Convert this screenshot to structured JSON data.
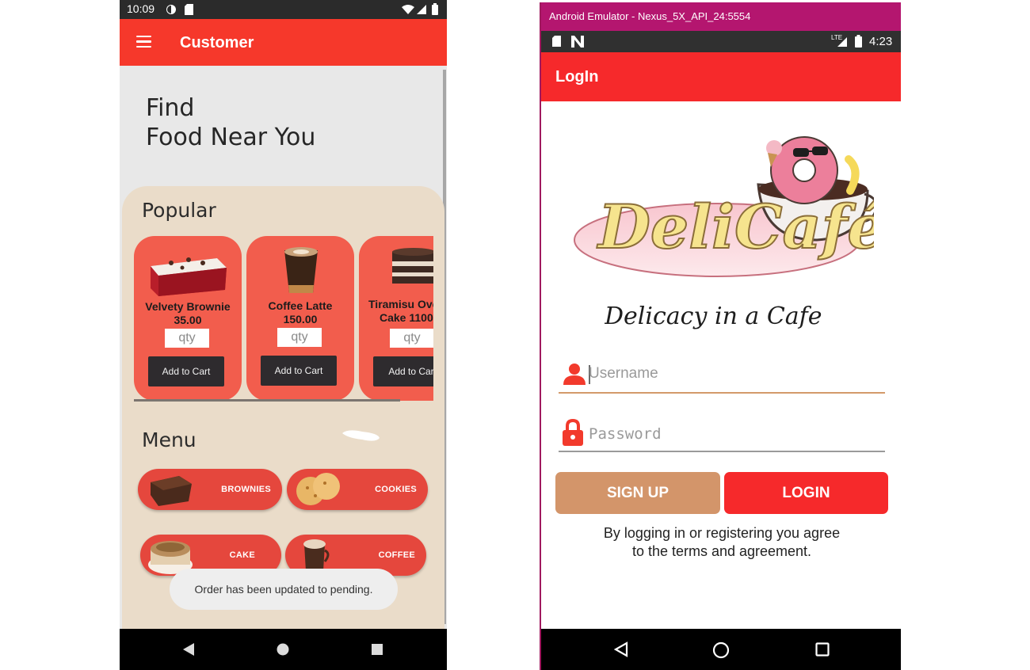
{
  "customer_screen": {
    "status_bar": {
      "time": "10:09"
    },
    "app_bar": {
      "title": "Customer",
      "menu_icon": "hamburger-icon"
    },
    "hero": {
      "line1": "Find",
      "line2": "Food Near You"
    },
    "popular": {
      "title": "Popular",
      "items": [
        {
          "name": "Velvety Brownie",
          "price": "35.00",
          "qty_placeholder": "qty",
          "button_label": "Add to Cart"
        },
        {
          "name": "Coffee Latte",
          "price": "150.00",
          "qty_placeholder": "qty",
          "button_label": "Add to Cart"
        },
        {
          "name": "Tiramisu Ove",
          "name_line2": "Cake 1100",
          "qty_placeholder": "qty",
          "button_label": "Add to Car"
        }
      ]
    },
    "menu": {
      "title": "Menu",
      "items": [
        {
          "label": "BROWNIES"
        },
        {
          "label": "COOKIES"
        },
        {
          "label": "CAKE"
        },
        {
          "label": "COFFEE"
        }
      ]
    },
    "toast": "Order has been updated to pending."
  },
  "login_screen": {
    "emulator_title": "Android Emulator - Nexus_5X_API_24:5554",
    "status_bar": {
      "time": "4:23"
    },
    "app_bar": {
      "title": "LogIn"
    },
    "logo": {
      "brand": "DeliCafé",
      "tagline": "Delicacy in a Cafe"
    },
    "username": {
      "placeholder": "Username"
    },
    "password": {
      "placeholder": "Password"
    },
    "signup_label": "SIGN UP",
    "login_label": "LOGIN",
    "terms_line1": "By logging in or registering you agree",
    "terms_line2": "to the terms and agreement.",
    "colors": {
      "primary_red": "#f6292b",
      "signup_tan": "#d3956a",
      "emulator_bar": "#b4166f"
    }
  }
}
